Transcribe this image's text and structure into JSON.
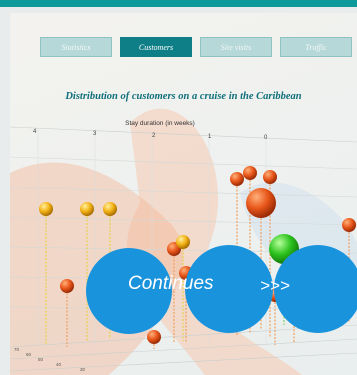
{
  "tabs": [
    {
      "label": "Statistics",
      "active": false
    },
    {
      "label": "Customers",
      "active": true
    },
    {
      "label": "Site visits",
      "active": false
    },
    {
      "label": "Traffic",
      "active": false
    }
  ],
  "overlay": {
    "continue_label": "Continues",
    "arrows": ">>>",
    "color": "#1a93dd"
  },
  "colors": {
    "header": "#0c9a9a",
    "active_tab": "#0e7f86",
    "title": "#0f6f7a",
    "ball_orange": "#e8561a",
    "ball_yellow": "#f2b215",
    "ball_green": "#2cc21e"
  },
  "chart_data": {
    "type": "scatter",
    "title": "Distribution of customers on a cruise in the Caribbean",
    "xlabel": "Stay duration (in weeks)",
    "x_ticks": [
      "4",
      "3",
      "2",
      "1",
      "0"
    ],
    "depth_ticks": [
      "70",
      "60",
      "50",
      "40",
      "30"
    ],
    "grid": true,
    "points": [
      {
        "color": "orange",
        "size": "small"
      },
      {
        "color": "orange",
        "size": "small"
      },
      {
        "color": "orange",
        "size": "small"
      },
      {
        "color": "yellow",
        "size": "small"
      },
      {
        "color": "yellow",
        "size": "small"
      },
      {
        "color": "yellow",
        "size": "small"
      },
      {
        "color": "orange",
        "size": "large"
      },
      {
        "color": "green",
        "size": "large"
      },
      {
        "color": "orange",
        "size": "small"
      },
      {
        "color": "orange",
        "size": "small"
      },
      {
        "color": "orange",
        "size": "small"
      },
      {
        "color": "yellow",
        "size": "small"
      },
      {
        "color": "orange",
        "size": "small"
      },
      {
        "color": "orange",
        "size": "small"
      },
      {
        "color": "orange",
        "size": "small"
      },
      {
        "color": "orange",
        "size": "small"
      }
    ]
  }
}
